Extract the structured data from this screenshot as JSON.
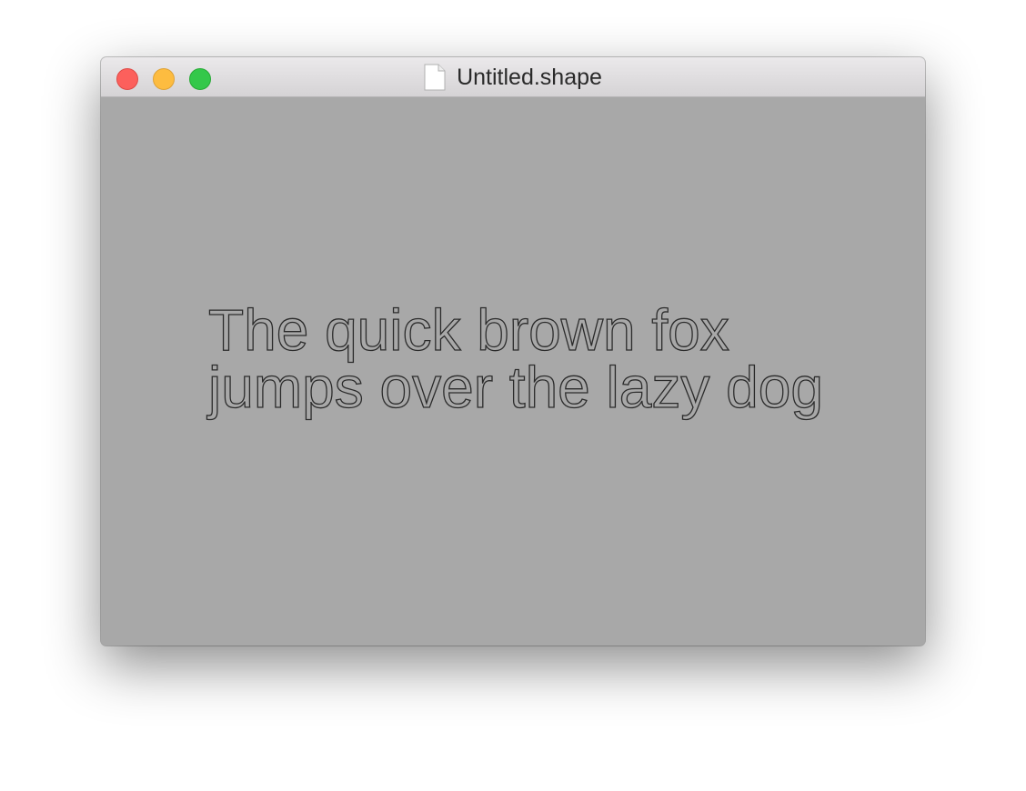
{
  "window": {
    "title": "Untitled.shape",
    "title_icon": "document-icon",
    "buttons": [
      "close",
      "minimize",
      "zoom"
    ]
  },
  "canvas": {
    "lines": [
      "The quick brown fox",
      "jumps over the lazy dog"
    ],
    "background_color": "#a8a8a8",
    "stroke_color": "#2b2b2b"
  }
}
